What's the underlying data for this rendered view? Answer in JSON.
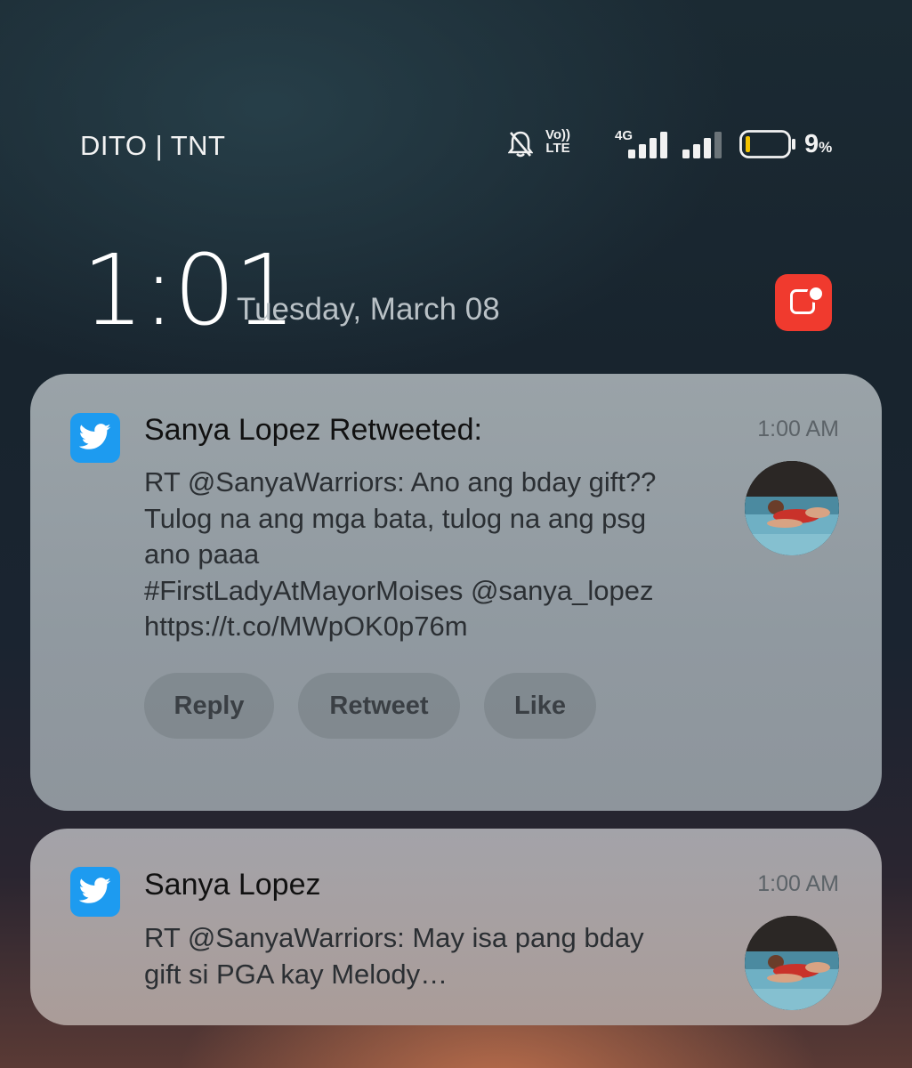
{
  "status_bar": {
    "carrier": "DITO | TNT",
    "volte_top": "Vo))",
    "volte_bottom": "LTE",
    "network": "4G",
    "battery_value": "9",
    "battery_unit": "%",
    "battery_level": 0.09,
    "icons": [
      "bell-off-icon",
      "volte-icon",
      "signal-icon",
      "signal-icon",
      "battery-icon"
    ]
  },
  "lockscreen": {
    "time": "1:01",
    "date": "Tuesday, March 08",
    "red_app_icon": "screen-record-icon"
  },
  "notifications": [
    {
      "app_icon": "twitter-bird-icon",
      "title": "Sanya Lopez Retweeted:",
      "time": "1:00 AM",
      "body": "RT @SanyaWarriors: Ano ang bday gift??\nTulog na ang mga bata, tulog na ang psg\nano paaa\n#FirstLadyAtMayorMoises @sanya_lopez\nhttps://t.co/MWpOK0p76m",
      "actions": [
        "Reply",
        "Retweet",
        "Like"
      ]
    },
    {
      "app_icon": "twitter-bird-icon",
      "title": "Sanya Lopez",
      "time": "1:00 AM",
      "body": "RT @SanyaWarriors: May isa pang bday\ngift si PGA kay Melody…"
    }
  ],
  "colors": {
    "twitter_blue": "#1d9bf0",
    "red_app": "#f03a2e",
    "battery_low": "#f2c200"
  }
}
